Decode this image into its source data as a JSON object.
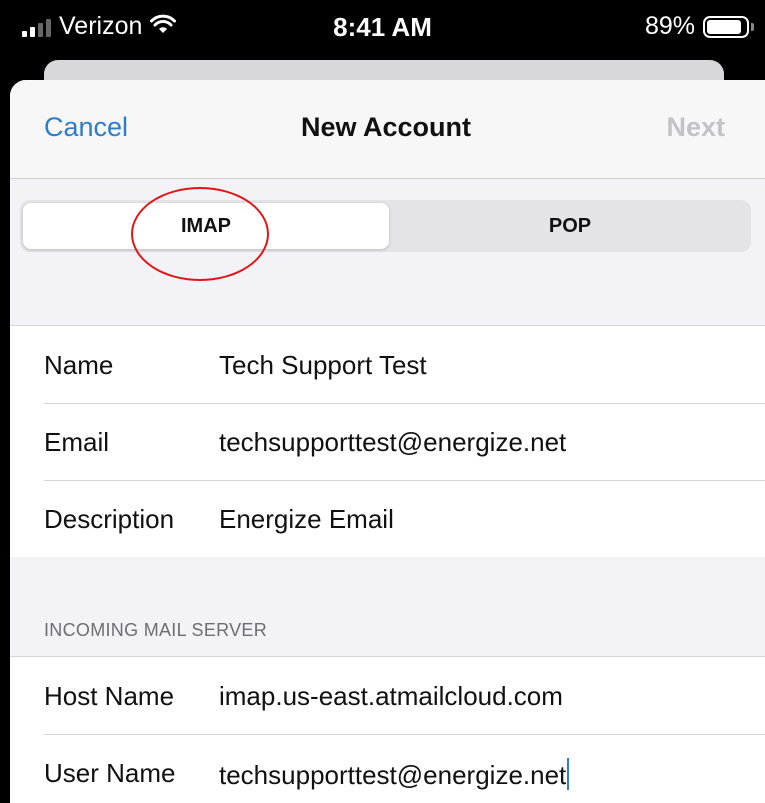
{
  "status_bar": {
    "carrier": "Verizon",
    "time": "8:41 AM",
    "battery_percent": "89%",
    "battery_level": 0.89
  },
  "nav": {
    "cancel_label": "Cancel",
    "title": "New Account",
    "next_label": "Next"
  },
  "segmented_control": {
    "options": [
      "IMAP",
      "POP"
    ],
    "selected": "IMAP"
  },
  "account": {
    "name_label": "Name",
    "name_value": "Tech Support Test",
    "email_label": "Email",
    "email_value": "techsupporttest@energize.net",
    "description_label": "Description",
    "description_value": "Energize Email"
  },
  "incoming": {
    "header": "INCOMING MAIL SERVER",
    "host_label": "Host Name",
    "host_value": "imap.us-east.atmailcloud.com",
    "user_label": "User Name",
    "user_value": "techsupporttest@energize.net"
  },
  "colors": {
    "accent": "#2f7cc7",
    "annotation": "#e01616"
  }
}
